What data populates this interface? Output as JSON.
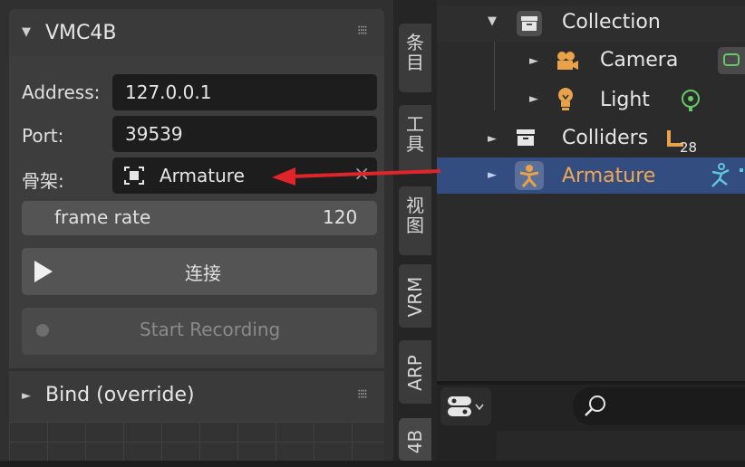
{
  "panel": {
    "title": "VMC4B",
    "address_label": "Address:",
    "address_value": "127.0.0.1",
    "port_label": "Port:",
    "port_value": "39539",
    "armature_label": "骨架:",
    "armature_value": "Armature",
    "frame_rate_label": "frame rate",
    "frame_rate_value": "120",
    "connect_label": "连接",
    "record_label": "Start Recording",
    "bind_title": "Bind (override)",
    "clear_glyph": "×"
  },
  "tabs": [
    "条目",
    "工具",
    "视图",
    "VRM",
    "ARP",
    "4B"
  ],
  "outliner": {
    "collection": "Collection",
    "camera": "Camera",
    "light": "Light",
    "colliders": "Colliders",
    "colliders_badge": "28",
    "armature": "Armature"
  },
  "colors": {
    "selection": "#334d80",
    "armature_orange": "#e8a24a",
    "arrow_red": "#e0242a"
  }
}
